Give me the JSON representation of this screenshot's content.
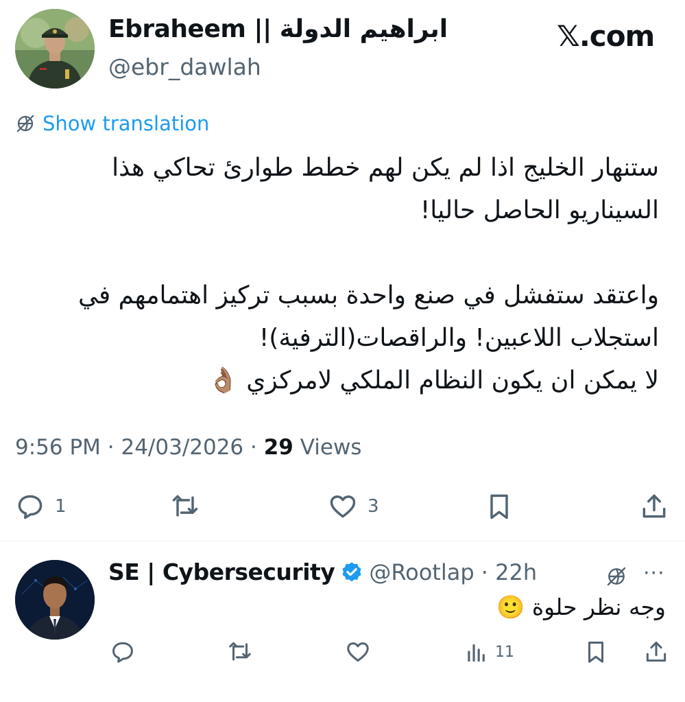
{
  "header": {
    "display_name": "Ebraheem || ابراهيم الدولة",
    "handle": "@ebr_dawlah",
    "site": "𝕏.com"
  },
  "translation": {
    "label": "Show translation",
    "icon": "globe-slash-icon"
  },
  "tweet": {
    "lines": [
      "ستنهار الخليج اذا لم يكن لهم خطط طوارئ تحاكي هذا",
      "السيناريو الحاصل حاليا!",
      "",
      "واعتقد ستفشل في صنع واحدة بسبب تركيز اهتمامهم في",
      "استجلاب اللاعبين! والراقصات(الترفية)!",
      "لا يمكن ان يكون النظام الملكي لامركزي 👌🏽"
    ]
  },
  "meta": {
    "time": "9:56 PM",
    "sep1": " · ",
    "date": "24/03/2026",
    "sep2": " · ",
    "views_count": "29",
    "views_label": " Views"
  },
  "actions": {
    "reply_count": "1",
    "retweet_count": "",
    "like_count": "3"
  },
  "reply": {
    "display_name": "SE | Cybersecurity",
    "handle": "@Rootlap · 22h",
    "text": "وجه نظر حلوة 🙂",
    "views_count": "11",
    "more": "···"
  },
  "colors": {
    "accent": "#1d9bf0",
    "muted": "#536471",
    "text": "#0f1419"
  }
}
